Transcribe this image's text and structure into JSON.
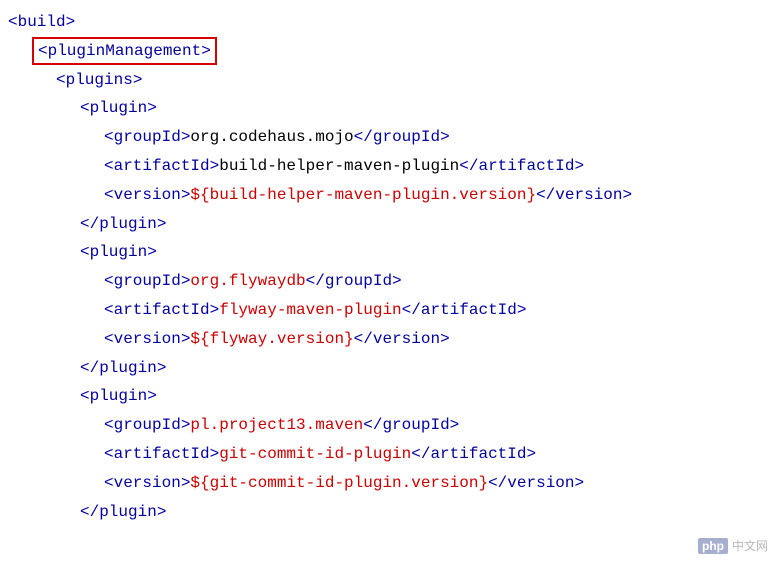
{
  "tags": {
    "build_open": "<build>",
    "pluginManagement_open": "<pluginManagement>",
    "plugins_open": "<plugins>",
    "plugin_open": "<plugin>",
    "plugin_close": "</plugin>",
    "groupId_open": "<groupId>",
    "groupId_close": "</groupId>",
    "artifactId_open": "<artifactId>",
    "artifactId_close": "</artifactId>",
    "version_open": "<version>",
    "version_close": "</version>"
  },
  "plugins": [
    {
      "groupId": "org.codehaus.mojo",
      "artifactId": "build-helper-maven-plugin",
      "version": "${build-helper-maven-plugin.version}"
    },
    {
      "groupId": "org.flywaydb",
      "artifactId": "flyway-maven-plugin",
      "version": "${flyway.version}"
    },
    {
      "groupId": "pl.project13.maven",
      "artifactId": "git-commit-id-plugin",
      "version": "${git-commit-id-plugin.version}"
    }
  ],
  "watermark": {
    "brand": "php",
    "text": "中文网"
  }
}
